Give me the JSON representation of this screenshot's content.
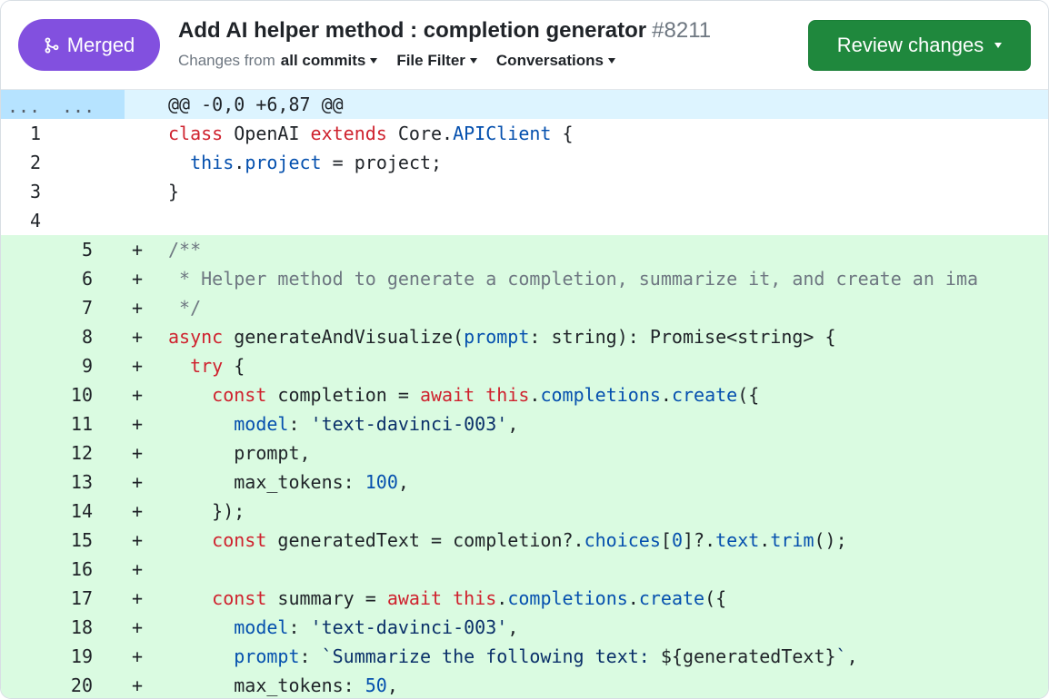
{
  "header": {
    "status_label": "Merged",
    "title": "Add AI helper method : completion generator",
    "pr_number": "#8211",
    "changes_from_label": "Changes from",
    "changes_from_value": "all commits",
    "file_filter_label": "File Filter",
    "conversations_label": "Conversations",
    "review_button_label": "Review changes"
  },
  "colors": {
    "merged": "#8250df",
    "review": "#1f883d",
    "added_bg": "#dafbe1",
    "hunk_bg": "#ddf4ff",
    "keyword": "#cf222e",
    "property": "#0550ae"
  },
  "diff": {
    "hunk_gutter_old": "...",
    "hunk_gutter_new": "...",
    "hunk_header": "@@ -0,0 +6,87 @@",
    "lines": [
      {
        "type": "context",
        "old": "1",
        "new": "",
        "sign": "",
        "code": "class OpenAI extends Core.APIClient {"
      },
      {
        "type": "context",
        "old": "2",
        "new": "",
        "sign": "",
        "code": "  this.project = project;"
      },
      {
        "type": "context",
        "old": "3",
        "new": "",
        "sign": "",
        "code": "}"
      },
      {
        "type": "context",
        "old": "4",
        "new": "",
        "sign": "",
        "code": ""
      },
      {
        "type": "add",
        "old": "",
        "new": "5",
        "sign": "+",
        "code": "/**"
      },
      {
        "type": "add",
        "old": "",
        "new": "6",
        "sign": "+",
        "code": " * Helper method to generate a completion, summarize it, and create an ima"
      },
      {
        "type": "add",
        "old": "",
        "new": "7",
        "sign": "+",
        "code": " */"
      },
      {
        "type": "add",
        "old": "",
        "new": "8",
        "sign": "+",
        "code": "async generateAndVisualize(prompt: string): Promise<string> {"
      },
      {
        "type": "add",
        "old": "",
        "new": "9",
        "sign": "+",
        "code": "  try {"
      },
      {
        "type": "add",
        "old": "",
        "new": "10",
        "sign": "+",
        "code": "    const completion = await this.completions.create({"
      },
      {
        "type": "add",
        "old": "",
        "new": "11",
        "sign": "+",
        "code": "      model: 'text-davinci-003',"
      },
      {
        "type": "add",
        "old": "",
        "new": "12",
        "sign": "+",
        "code": "      prompt,"
      },
      {
        "type": "add",
        "old": "",
        "new": "13",
        "sign": "+",
        "code": "      max_tokens: 100,"
      },
      {
        "type": "add",
        "old": "",
        "new": "14",
        "sign": "+",
        "code": "    });"
      },
      {
        "type": "add",
        "old": "",
        "new": "15",
        "sign": "+",
        "code": "    const generatedText = completion?.choices[0]?.text.trim();"
      },
      {
        "type": "add",
        "old": "",
        "new": "16",
        "sign": "+",
        "code": ""
      },
      {
        "type": "add",
        "old": "",
        "new": "17",
        "sign": "+",
        "code": "    const summary = await this.completions.create({"
      },
      {
        "type": "add",
        "old": "",
        "new": "18",
        "sign": "+",
        "code": "      model: 'text-davinci-003',"
      },
      {
        "type": "add",
        "old": "",
        "new": "19",
        "sign": "+",
        "code": "      prompt: `Summarize the following text: ${generatedText}`,"
      },
      {
        "type": "add",
        "old": "",
        "new": "20",
        "sign": "+",
        "code": "      max_tokens: 50,"
      }
    ]
  }
}
